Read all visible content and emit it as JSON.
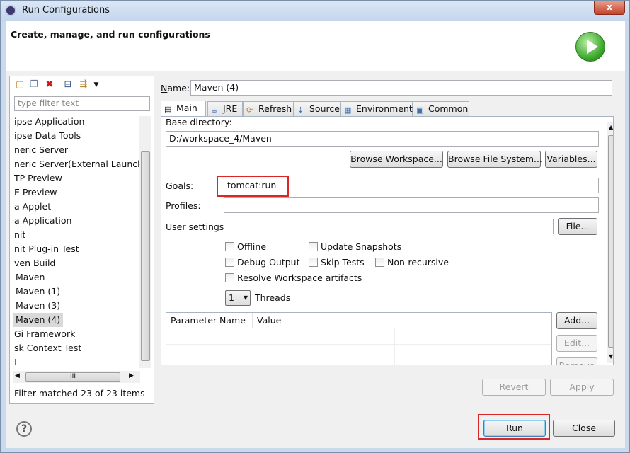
{
  "window": {
    "title": "Run Configurations",
    "close_glyph": "x"
  },
  "header": {
    "title": "Create, manage, and run configurations",
    "run_icon": "run-icon"
  },
  "left": {
    "toolbar_icons": [
      "new-config-icon",
      "duplicate-icon",
      "delete-icon",
      "collapse-all-icon",
      "filter-icon",
      "dropdown-icon"
    ],
    "filter_placeholder": "type filter text",
    "tree_items": [
      "ipse Application",
      "ipse Data Tools",
      "neric Server",
      "neric Server(External Launch)",
      "TP Preview",
      "E Preview",
      "a Applet",
      "a Application",
      "nit",
      "nit Plug-in Test",
      "ven Build",
      "Maven",
      "Maven (1)",
      "Maven (3)",
      "Maven (4)",
      "Gi Framework",
      "sk Context Test",
      "L"
    ],
    "selected_item": "Maven (4)",
    "scroll_glyph": "III",
    "status": "Filter matched 23 of 23 items"
  },
  "right": {
    "name_label": "Name:",
    "name_value": "Maven (4)",
    "tabs": [
      {
        "label": "Main",
        "icon": "main-tab-icon"
      },
      {
        "label": "JRE",
        "icon": "jre-icon"
      },
      {
        "label": "Refresh",
        "icon": "refresh-icon"
      },
      {
        "label": "Source",
        "icon": "source-icon"
      },
      {
        "label": "Environment",
        "icon": "environment-icon"
      },
      {
        "label": "Common",
        "icon": "common-icon"
      }
    ],
    "base_dir_label": "Base directory:",
    "base_dir_value": "D:/workspace_4/Maven",
    "browse_workspace": "Browse Workspace...",
    "browse_filesystem": "Browse File System...",
    "variables": "Variables...",
    "goals_label": "Goals:",
    "goals_value": "tomcat:run",
    "profiles_label": "Profiles:",
    "profiles_value": "",
    "user_settings_label": "User settings:",
    "user_settings_value": "",
    "file_button": "File...",
    "checkboxes": {
      "offline": "Offline",
      "update_snapshots": "Update Snapshots",
      "debug_output": "Debug Output",
      "skip_tests": "Skip Tests",
      "non_recursive": "Non-recursive",
      "resolve_workspace": "Resolve Workspace artifacts"
    },
    "threads_value": "1",
    "threads_label": "Threads",
    "param_headers": [
      "Parameter Name",
      "Value"
    ],
    "add_button": "Add...",
    "edit_button": "Edit...",
    "remove_button": "Remove",
    "revert_button": "Revert",
    "apply_button": "Apply"
  },
  "bottom": {
    "help_glyph": "?",
    "run_button": "Run",
    "close_button": "Close"
  },
  "colors": {
    "highlight_border": "#d8262b",
    "selection": "#d9d9d9"
  }
}
